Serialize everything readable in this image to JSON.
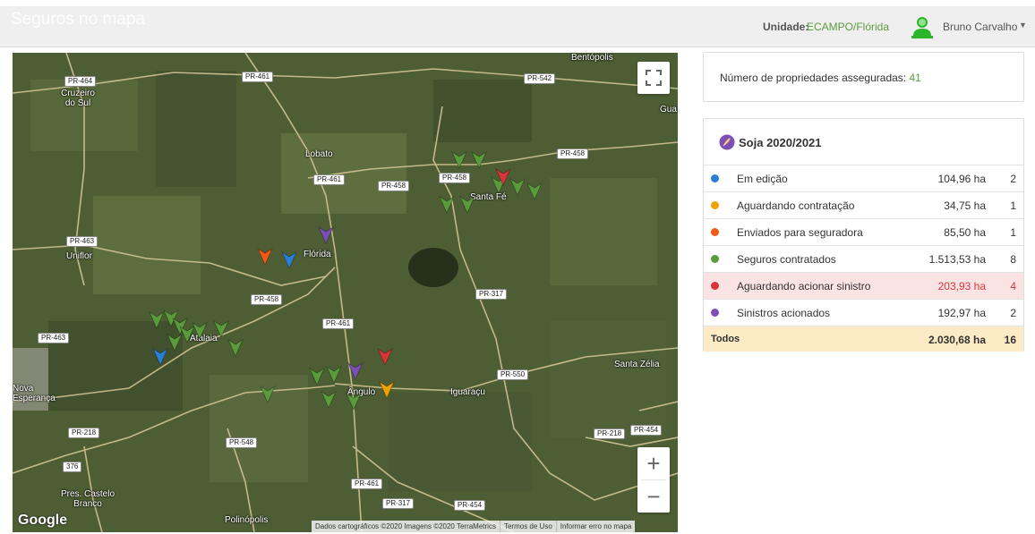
{
  "header": {
    "title": "Seguros no mapa",
    "unit_label": "Unidade:",
    "unit_value": "ECAMPO/Flórida",
    "user_name": "Bruno Carvalho",
    "accent_color": "#5a9b3c"
  },
  "map": {
    "road_labels": [
      "PR-464",
      "PR-461",
      "PR-542",
      "PR-458",
      "PR-461",
      "PR-458",
      "PR-458",
      "PR-463",
      "PR-458",
      "PR-317",
      "PR-461",
      "PR-463",
      "PR-550",
      "PR-218",
      "PR-548",
      "PR-461",
      "PR-317",
      "PR-454",
      "PR-218",
      "PR-454",
      "376"
    ],
    "town_labels": [
      "Bentópolis",
      "Cruzeiro do Sul",
      "Lobato",
      "Santa Fé",
      "Uniflor",
      "Flórida",
      "Atalaia",
      "Santa Zélia",
      "Nova Esperança",
      "Ângulo",
      "Iguaraçu",
      "Pres. Castelo Branco",
      "Polinópolis",
      "Gua"
    ],
    "google_logo": "Google",
    "attribution": [
      "Dados cartográficos ©2020 Imagens ©2020 TerraMetrics",
      "Termos de Uso",
      "Informar erro no mapa"
    ],
    "zoom_in": "+",
    "zoom_out": "−",
    "icons": {
      "fullscreen": "fullscreen-icon",
      "marker": "map-marker-icon"
    }
  },
  "summary": {
    "label": "Número de propriedades asseguradas:",
    "value": "41"
  },
  "crop": {
    "title": "Soja 2020/2021",
    "rows": [
      {
        "label": "Em edição",
        "area": "104,96 ha",
        "count": "2",
        "color": "#2a7fd4"
      },
      {
        "label": "Aguardando contratação",
        "area": "34,75 ha",
        "count": "1",
        "color": "#f0a300"
      },
      {
        "label": "Enviados para seguradora",
        "area": "85,50 ha",
        "count": "1",
        "color": "#f05a14"
      },
      {
        "label": "Seguros contratados",
        "area": "1.513,53 ha",
        "count": "8",
        "color": "#5a9b3c"
      },
      {
        "label": "Aguardando acionar sinistro",
        "area": "203,93 ha",
        "count": "4",
        "color": "#d9343a"
      },
      {
        "label": "Sinistros acionados",
        "area": "192,97 ha",
        "count": "2",
        "color": "#7b4fb5"
      }
    ],
    "total": {
      "label": "Todos",
      "area": "2.030,68 ha",
      "count": "16"
    }
  }
}
